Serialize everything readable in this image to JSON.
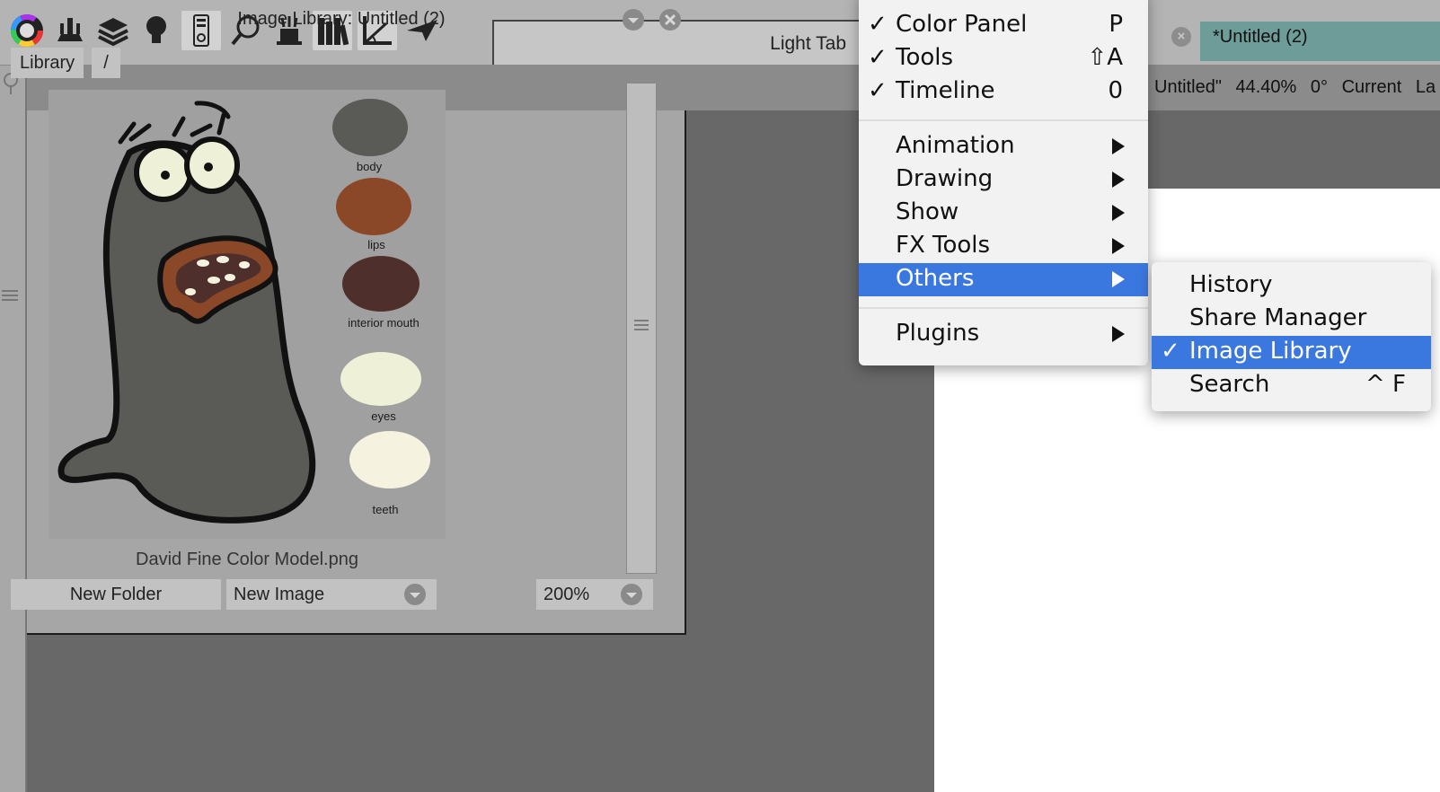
{
  "toolbar": {
    "tools": [
      "color-wheel-icon",
      "stamp-tools-icon",
      "layers-icon",
      "lightbulb-icon",
      "remote-icon",
      "search-icon",
      "magic-hat-icon",
      "library-books-icon",
      "measure-angle-icon",
      "paper-plane-icon"
    ],
    "light_table_label": "Light Tab",
    "tab_title": "*Untitled (2)"
  },
  "status": {
    "doc": "Untitled\"",
    "zoom": "44.40%",
    "rotation": "0°",
    "layer": "Current La"
  },
  "panel": {
    "title": "Image Library: Untitled (2)",
    "crumbs": [
      "Library",
      "/"
    ],
    "thumbnail_caption": "David Fine Color Model.png",
    "swatch_labels": [
      "body",
      "lips",
      "interior mouth",
      "eyes",
      "teeth"
    ],
    "new_folder": "New Folder",
    "new_image": "New Image",
    "zoom": "200%"
  },
  "colors": {
    "body": "#5a5a57",
    "lips": "#8b4828",
    "interior_mouth": "#4e2f2b",
    "eyes": "#eef1d8",
    "teeth": "#f5f3e0",
    "menu_highlight": "#3a78e0",
    "tab_accent": "#6d9c99"
  },
  "main_menu": {
    "checked_items": [
      {
        "label": "Color Panel",
        "shortcut": "P"
      },
      {
        "label": "Tools",
        "shortcut": "⇧A"
      },
      {
        "label": "Timeline",
        "shortcut": "0"
      }
    ],
    "submenus": [
      "Animation",
      "Drawing",
      "Show",
      "FX Tools",
      "Others"
    ],
    "plugins": "Plugins",
    "check": "✓"
  },
  "others_menu": {
    "items": [
      {
        "label": "History",
        "shortcut": ""
      },
      {
        "label": "Share Manager",
        "shortcut": ""
      },
      {
        "label": "Image Library",
        "shortcut": ""
      },
      {
        "label": "Search",
        "shortcut": "^ F"
      }
    ]
  }
}
